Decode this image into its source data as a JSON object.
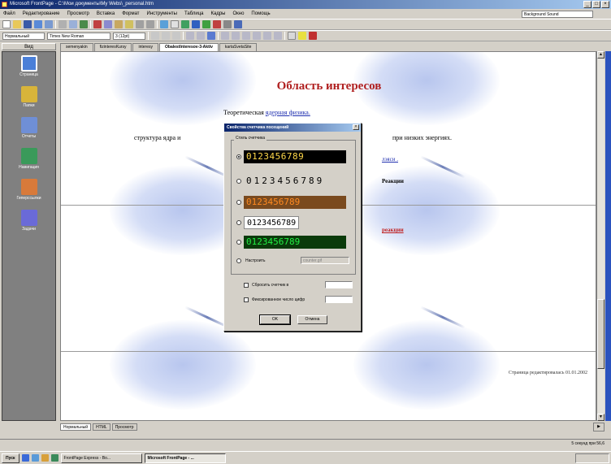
{
  "window": {
    "title": "Microsoft FrontPage - C:\\Мои документы\\My Webs\\_personal.htm",
    "controls": [
      "_",
      "□",
      "×"
    ]
  },
  "menu": {
    "items": [
      "Файл",
      "Редактирование",
      "Просмотр",
      "Вставка",
      "Формат",
      "Инструменты",
      "Таблица",
      "Кадры",
      "Окно",
      "Помощь"
    ],
    "style_box": "Background Sound"
  },
  "toolbar2": {
    "style_select": "Нормальный",
    "font_select": "Times New Roman",
    "size_select": "3 (12pt)"
  },
  "views": {
    "header": "Вид",
    "items": [
      {
        "label": "Страница",
        "color": "#4a7fd8"
      },
      {
        "label": "Папки",
        "color": "#d8b43a"
      },
      {
        "label": "Отчеты",
        "color": "#6f8fd6"
      },
      {
        "label": "Навигация",
        "color": "#3a9a5a"
      },
      {
        "label": "Гиперссылки",
        "color": "#d87a3a"
      },
      {
        "label": "Задачи",
        "color": "#6a6ad8"
      }
    ]
  },
  "doc_tabs": [
    {
      "label": "semenyakin",
      "active": false
    },
    {
      "label": "fizinteresKursy",
      "active": false
    },
    {
      "label": "interesy",
      "active": false
    },
    {
      "label": "ObalestInteresov-3-Aktiv",
      "active": true
    },
    {
      "label": "kartaSvetaSite",
      "active": false
    }
  ],
  "page": {
    "title": "Область интересов",
    "subtitle_prefix": "Теоретическая",
    "subtitle_link": "ядерная физика.",
    "line2_left": "структура ядра и",
    "line2_right": "при низких энергиях.",
    "frag_right1": "лэяси .",
    "frag_right2": "Реакции",
    "frag_link": "реакции",
    "footer_note": "Страница редактировалась 01.01.2002"
  },
  "dialog": {
    "title": "Свойства счетчика посещений",
    "close": "×",
    "group_label": "Стиль счетчика",
    "styles": [
      {
        "digits": "0123456789",
        "checked": true
      },
      {
        "digits": "0123456789",
        "checked": false
      },
      {
        "digits": "0123456789",
        "checked": false
      },
      {
        "digits": "0123456789",
        "checked": false
      },
      {
        "digits": "0123456789",
        "checked": false
      }
    ],
    "custom_label": "Настроить",
    "custom_value": "counter.gif",
    "reset_label": "Сбросить счетчик в",
    "reset_value": "",
    "fixed_label": "Фиксированное число цифр",
    "fixed_value": "",
    "ok": "OK",
    "cancel": "Отмена"
  },
  "viewtabs": [
    "Нормальный",
    "HTML",
    "Просмотр"
  ],
  "status": {
    "right": "5 секунд при 56,6"
  },
  "taskbar": {
    "start": "Пуск",
    "tasks": [
      {
        "label": "FrontPage Express - Bo...",
        "active": false
      },
      {
        "label": "Microsoft FrontPage - ...",
        "active": true
      }
    ]
  },
  "colors": {
    "title_red": "#b02020",
    "link_blue": "#2030b0",
    "titlebar_start": "#0a246a",
    "titlebar_end": "#a6caf0"
  }
}
